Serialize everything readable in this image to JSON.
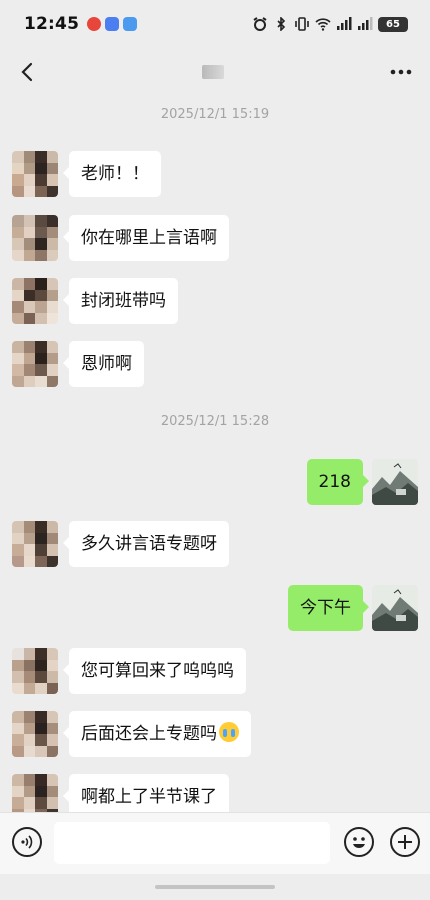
{
  "status_bar": {
    "time": "12:45",
    "battery": "65",
    "app_icons": [
      {
        "name": "weibo-notify-icon",
        "color": "#e8463b"
      },
      {
        "name": "app-notify-icon",
        "color": "#4b7ef0"
      },
      {
        "name": "app-notify-icon-2",
        "color": "#4b9af0"
      }
    ]
  },
  "nav": {
    "back_icon": "chevron-left-icon",
    "more_icon": "ellipsis-icon"
  },
  "timestamps": [
    "2025/12/1 15:19",
    "2025/12/1 15:28"
  ],
  "messages": [
    {
      "side": "in",
      "text": "老师！！"
    },
    {
      "side": "in",
      "text": "你在哪里上言语啊"
    },
    {
      "side": "in",
      "text": "封闭班带吗"
    },
    {
      "side": "in",
      "text": "恩师啊"
    },
    {
      "side": "out",
      "text": "218"
    },
    {
      "side": "in",
      "text": "多久讲言语专题呀"
    },
    {
      "side": "out",
      "text": "今下午"
    },
    {
      "side": "in",
      "text": "您可算回来了呜呜呜"
    },
    {
      "side": "in",
      "text": "后面还会上专题吗",
      "emoji": "crying-emoji"
    },
    {
      "side": "in",
      "text": "啊都上了半节课了"
    }
  ],
  "input_bar": {
    "placeholder": "",
    "voice_icon": "voice-icon",
    "emoji_icon": "smiley-icon",
    "plus_icon": "plus-icon"
  },
  "colors": {
    "background": "#ededed",
    "outgoing_bubble": "#95ec69",
    "incoming_bubble": "#ffffff"
  }
}
